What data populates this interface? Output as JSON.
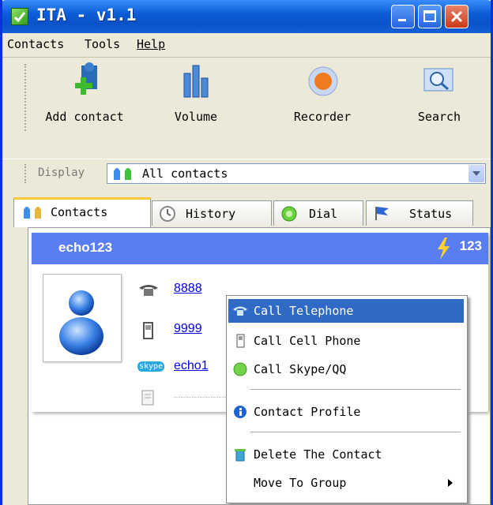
{
  "window": {
    "title": "ITA - v1.1"
  },
  "menubar": {
    "items": [
      "Contacts",
      "Tools",
      "Help"
    ]
  },
  "toolbar": {
    "buttons": [
      "Add contact",
      "Volume",
      "Recorder",
      "Search"
    ]
  },
  "display": {
    "label": "Display",
    "selected": "All contacts"
  },
  "tabs": [
    "Contacts",
    "History",
    "Dial",
    "Status"
  ],
  "contact": {
    "name": "echo123",
    "count": "123",
    "telephone": "8888",
    "cell": "9999",
    "skype": "echo1",
    "skype_badge": "skype"
  },
  "context_menu": {
    "items": [
      "Call Telephone",
      "Call Cell Phone",
      "Call Skype/QQ",
      "Contact Profile",
      "Delete The Contact",
      "Move To Group"
    ]
  },
  "colors": {
    "title_blue": "#0a52c8",
    "card_header": "#5b7df2",
    "menu_highlight": "#316ac5"
  }
}
